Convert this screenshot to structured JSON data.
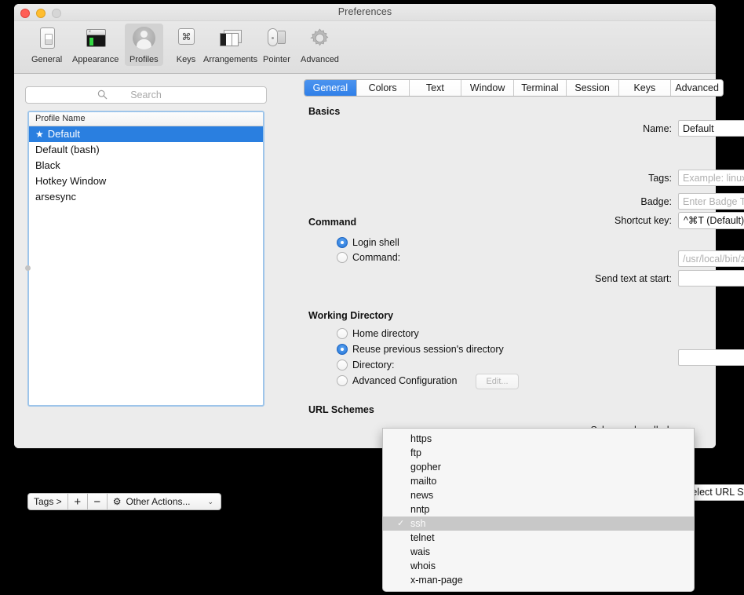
{
  "window": {
    "title": "Preferences",
    "traffic_lights": [
      "close",
      "minimize",
      "zoom"
    ]
  },
  "toolbar": {
    "items": [
      {
        "label": "General",
        "icon": "general-icon",
        "selected": false
      },
      {
        "label": "Appearance",
        "icon": "appearance-icon",
        "selected": false
      },
      {
        "label": "Profiles",
        "icon": "profiles-icon",
        "selected": true
      },
      {
        "label": "Keys",
        "icon": "keys-icon",
        "selected": false
      },
      {
        "label": "Arrangements",
        "icon": "arrangements-icon",
        "selected": false
      },
      {
        "label": "Pointer",
        "icon": "pointer-icon",
        "selected": false
      },
      {
        "label": "Advanced",
        "icon": "gear-icon",
        "selected": false
      }
    ]
  },
  "sidebar": {
    "search": {
      "placeholder": "Search",
      "value": ""
    },
    "list_header": "Profile Name",
    "profiles": [
      {
        "name": "Default",
        "default": true,
        "selected": true
      },
      {
        "name": "Default (bash)",
        "default": false,
        "selected": false
      },
      {
        "name": "Black",
        "default": false,
        "selected": false
      },
      {
        "name": "Hotkey Window",
        "default": false,
        "selected": false
      },
      {
        "name": "arsesync",
        "default": false,
        "selected": false
      }
    ],
    "star_glyph": "★",
    "toolbar": {
      "tags_label": "Tags >",
      "add_label": "+",
      "remove_label": "−",
      "other_actions_label": "Other Actions...",
      "gear_glyph": "⚙",
      "chevron_glyph": "⌄"
    }
  },
  "tabs": [
    {
      "label": "General",
      "active": true
    },
    {
      "label": "Colors",
      "active": false
    },
    {
      "label": "Text",
      "active": false
    },
    {
      "label": "Window",
      "active": false
    },
    {
      "label": "Terminal",
      "active": false
    },
    {
      "label": "Session",
      "active": false
    },
    {
      "label": "Keys",
      "active": false
    },
    {
      "label": "Advanced",
      "active": false
    }
  ],
  "general_tab": {
    "basics": {
      "heading": "Basics",
      "name_label": "Name:",
      "name_value": "Default",
      "shortcut_label": "Shortcut key:",
      "shortcut_value": "^⌘T (Default)",
      "tags_label": "Tags:",
      "tags_placeholder": "Example: linux, dark bg, tag/subtag/subsubtag",
      "tags_value": "",
      "badge_label": "Badge:",
      "badge_placeholder": "Enter Badge Text",
      "badge_value": ""
    },
    "command": {
      "heading": "Command",
      "login_shell_label": "Login shell",
      "login_shell_selected": true,
      "command_label": "Command:",
      "command_selected": false,
      "command_placeholder": "/usr/local/bin/zsh",
      "command_value": "",
      "send_text_label": "Send text at start:",
      "send_text_value": ""
    },
    "working_directory": {
      "heading": "Working Directory",
      "options": [
        {
          "label": "Home directory",
          "selected": false
        },
        {
          "label": "Reuse previous session's directory",
          "selected": true
        },
        {
          "label": "Directory:",
          "selected": false
        },
        {
          "label": "Advanced Configuration",
          "selected": false
        }
      ],
      "directory_value": "",
      "edit_button_label": "Edit..."
    },
    "url_schemes": {
      "heading": "URL Schemes",
      "schemes_label": "Schemes handled:",
      "select_value": "Select URL Schemes...",
      "dropdown_open": true,
      "check_glyph": "✓",
      "options": [
        {
          "label": "https",
          "checked": false,
          "highlighted": false
        },
        {
          "label": "ftp",
          "checked": false,
          "highlighted": false
        },
        {
          "label": "gopher",
          "checked": false,
          "highlighted": false
        },
        {
          "label": "mailto",
          "checked": false,
          "highlighted": false
        },
        {
          "label": "news",
          "checked": false,
          "highlighted": false
        },
        {
          "label": "nntp",
          "checked": false,
          "highlighted": false
        },
        {
          "label": "ssh",
          "checked": true,
          "highlighted": true
        },
        {
          "label": "telnet",
          "checked": false,
          "highlighted": false
        },
        {
          "label": "wais",
          "checked": false,
          "highlighted": false
        },
        {
          "label": "whois",
          "checked": false,
          "highlighted": false
        },
        {
          "label": "x-man-page",
          "checked": false,
          "highlighted": false
        }
      ]
    }
  },
  "colors": {
    "accent": "#2f7fe8",
    "selection": "#2a7fe0",
    "window_bg": "#ececec",
    "desktop_bg": "#000000"
  }
}
